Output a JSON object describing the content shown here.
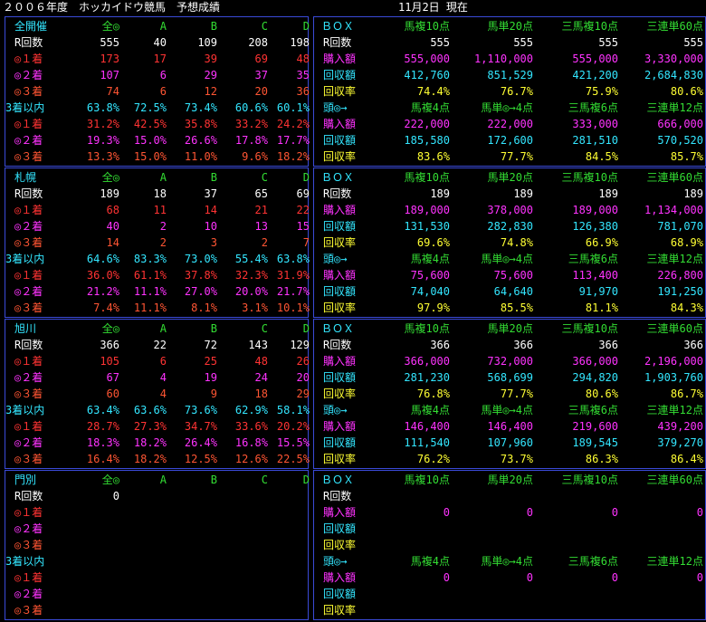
{
  "header": {
    "title": "２００６年度　ホッカイドウ競馬　予想成績",
    "date": "11月2日 現在"
  },
  "colors": {
    "blue": "#3a4ad8",
    "cyan": "#33e6ff",
    "red": "#ff3333",
    "magenta": "#ff33ff",
    "orange": "#ff5533",
    "green": "#33dd33",
    "yellow": "#ffff33",
    "white": "#ffffff"
  },
  "sections": [
    {
      "name": "全開催",
      "left": {
        "cols": [
          "全◎",
          "A",
          "B",
          "C",
          "D"
        ],
        "rows": [
          {
            "label": "R回数",
            "values": [
              "555",
              "40",
              "109",
              "208",
              "198"
            ]
          },
          {
            "label": "◎１着",
            "values": [
              "173",
              "17",
              "39",
              "69",
              "48"
            ]
          },
          {
            "label": "◎２着",
            "values": [
              "107",
              "6",
              "29",
              "37",
              "35"
            ]
          },
          {
            "label": "◎３着",
            "values": [
              "74",
              "6",
              "12",
              "20",
              "36"
            ]
          },
          {
            "label": "3着以内",
            "values": [
              "63.8%",
              "72.5%",
              "73.4%",
              "60.6%",
              "60.1%"
            ]
          },
          {
            "label": "◎１着",
            "values": [
              "31.2%",
              "42.5%",
              "35.8%",
              "33.2%",
              "24.2%"
            ]
          },
          {
            "label": "◎２着",
            "values": [
              "19.3%",
              "15.0%",
              "26.6%",
              "17.8%",
              "17.7%"
            ]
          },
          {
            "label": "◎３着",
            "values": [
              "13.3%",
              "15.0%",
              "11.0%",
              "9.6%",
              "18.2%"
            ]
          }
        ]
      },
      "right": {
        "head1": [
          "ＢＯＸ",
          "馬複10点",
          "馬単20点",
          "三馬複10点",
          "三連単60点"
        ],
        "rows1": [
          {
            "label": "R回数",
            "values": [
              "555",
              "555",
              "555",
              "555"
            ]
          },
          {
            "label": "購入額",
            "values": [
              "555,000",
              "1,110,000",
              "555,000",
              "3,330,000"
            ]
          },
          {
            "label": "回収額",
            "values": [
              "412,760",
              "851,529",
              "421,200",
              "2,684,830"
            ]
          },
          {
            "label": "回収率",
            "values": [
              "74.4%",
              "76.7%",
              "75.9%",
              "80.6%"
            ]
          }
        ],
        "head2": [
          "頭◎→",
          "馬複4点",
          "馬単◎→4点",
          "三馬複6点",
          "三連単12点"
        ],
        "rows2": [
          {
            "label": "購入額",
            "values": [
              "222,000",
              "222,000",
              "333,000",
              "666,000"
            ]
          },
          {
            "label": "回収額",
            "values": [
              "185,580",
              "172,600",
              "281,510",
              "570,520"
            ]
          },
          {
            "label": "回収率",
            "values": [
              "83.6%",
              "77.7%",
              "84.5%",
              "85.7%"
            ]
          }
        ]
      }
    },
    {
      "name": "札幌",
      "left": {
        "cols": [
          "全◎",
          "A",
          "B",
          "C",
          "D"
        ],
        "rows": [
          {
            "label": "R回数",
            "values": [
              "189",
              "18",
              "37",
              "65",
              "69"
            ]
          },
          {
            "label": "◎１着",
            "values": [
              "68",
              "11",
              "14",
              "21",
              "22"
            ]
          },
          {
            "label": "◎２着",
            "values": [
              "40",
              "2",
              "10",
              "13",
              "15"
            ]
          },
          {
            "label": "◎３着",
            "values": [
              "14",
              "2",
              "3",
              "2",
              "7"
            ]
          },
          {
            "label": "3着以内",
            "values": [
              "64.6%",
              "83.3%",
              "73.0%",
              "55.4%",
              "63.8%"
            ]
          },
          {
            "label": "◎１着",
            "values": [
              "36.0%",
              "61.1%",
              "37.8%",
              "32.3%",
              "31.9%"
            ]
          },
          {
            "label": "◎２着",
            "values": [
              "21.2%",
              "11.1%",
              "27.0%",
              "20.0%",
              "21.7%"
            ]
          },
          {
            "label": "◎３着",
            "values": [
              "7.4%",
              "11.1%",
              "8.1%",
              "3.1%",
              "10.1%"
            ]
          }
        ]
      },
      "right": {
        "head1": [
          "ＢＯＸ",
          "馬複10点",
          "馬単20点",
          "三馬複10点",
          "三連単60点"
        ],
        "rows1": [
          {
            "label": "R回数",
            "values": [
              "189",
              "189",
              "189",
              "189"
            ]
          },
          {
            "label": "購入額",
            "values": [
              "189,000",
              "378,000",
              "189,000",
              "1,134,000"
            ]
          },
          {
            "label": "回収額",
            "values": [
              "131,530",
              "282,830",
              "126,380",
              "781,070"
            ]
          },
          {
            "label": "回収率",
            "values": [
              "69.6%",
              "74.8%",
              "66.9%",
              "68.9%"
            ]
          }
        ],
        "head2": [
          "頭◎→",
          "馬複4点",
          "馬単◎→4点",
          "三馬複6点",
          "三連単12点"
        ],
        "rows2": [
          {
            "label": "購入額",
            "values": [
              "75,600",
              "75,600",
              "113,400",
              "226,800"
            ]
          },
          {
            "label": "回収額",
            "values": [
              "74,040",
              "64,640",
              "91,970",
              "191,250"
            ]
          },
          {
            "label": "回収率",
            "values": [
              "97.9%",
              "85.5%",
              "81.1%",
              "84.3%"
            ]
          }
        ]
      }
    },
    {
      "name": "旭川",
      "left": {
        "cols": [
          "全◎",
          "A",
          "B",
          "C",
          "D"
        ],
        "rows": [
          {
            "label": "R回数",
            "values": [
              "366",
              "22",
              "72",
              "143",
              "129"
            ]
          },
          {
            "label": "◎１着",
            "values": [
              "105",
              "6",
              "25",
              "48",
              "26"
            ]
          },
          {
            "label": "◎２着",
            "values": [
              "67",
              "4",
              "19",
              "24",
              "20"
            ]
          },
          {
            "label": "◎３着",
            "values": [
              "60",
              "4",
              "9",
              "18",
              "29"
            ]
          },
          {
            "label": "3着以内",
            "values": [
              "63.4%",
              "63.6%",
              "73.6%",
              "62.9%",
              "58.1%"
            ]
          },
          {
            "label": "◎１着",
            "values": [
              "28.7%",
              "27.3%",
              "34.7%",
              "33.6%",
              "20.2%"
            ]
          },
          {
            "label": "◎２着",
            "values": [
              "18.3%",
              "18.2%",
              "26.4%",
              "16.8%",
              "15.5%"
            ]
          },
          {
            "label": "◎３着",
            "values": [
              "16.4%",
              "18.2%",
              "12.5%",
              "12.6%",
              "22.5%"
            ]
          }
        ]
      },
      "right": {
        "head1": [
          "ＢＯＸ",
          "馬複10点",
          "馬単20点",
          "三馬複10点",
          "三連単60点"
        ],
        "rows1": [
          {
            "label": "R回数",
            "values": [
              "366",
              "366",
              "366",
              "366"
            ]
          },
          {
            "label": "購入額",
            "values": [
              "366,000",
              "732,000",
              "366,000",
              "2,196,000"
            ]
          },
          {
            "label": "回収額",
            "values": [
              "281,230",
              "568,699",
              "294,820",
              "1,903,760"
            ]
          },
          {
            "label": "回収率",
            "values": [
              "76.8%",
              "77.7%",
              "80.6%",
              "86.7%"
            ]
          }
        ],
        "head2": [
          "頭◎→",
          "馬複4点",
          "馬単◎→4点",
          "三馬複6点",
          "三連単12点"
        ],
        "rows2": [
          {
            "label": "購入額",
            "values": [
              "146,400",
              "146,400",
              "219,600",
              "439,200"
            ]
          },
          {
            "label": "回収額",
            "values": [
              "111,540",
              "107,960",
              "189,545",
              "379,270"
            ]
          },
          {
            "label": "回収率",
            "values": [
              "76.2%",
              "73.7%",
              "86.3%",
              "86.4%"
            ]
          }
        ]
      }
    },
    {
      "name": "門別",
      "left": {
        "cols": [
          "全◎",
          "A",
          "B",
          "C",
          "D"
        ],
        "rows": [
          {
            "label": "R回数",
            "values": [
              "0",
              "",
              "",
              "",
              ""
            ]
          },
          {
            "label": "◎１着",
            "values": [
              "",
              "",
              "",
              "",
              ""
            ]
          },
          {
            "label": "◎２着",
            "values": [
              "",
              "",
              "",
              "",
              ""
            ]
          },
          {
            "label": "◎３着",
            "values": [
              "",
              "",
              "",
              "",
              ""
            ]
          },
          {
            "label": "3着以内",
            "values": [
              "",
              "",
              "",
              "",
              ""
            ]
          },
          {
            "label": "◎１着",
            "values": [
              "",
              "",
              "",
              "",
              ""
            ]
          },
          {
            "label": "◎２着",
            "values": [
              "",
              "",
              "",
              "",
              ""
            ]
          },
          {
            "label": "◎３着",
            "values": [
              "",
              "",
              "",
              "",
              ""
            ]
          }
        ]
      },
      "right": {
        "head1": [
          "ＢＯＸ",
          "馬複10点",
          "馬単20点",
          "三馬複10点",
          "三連単60点"
        ],
        "rows1": [
          {
            "label": "R回数",
            "values": [
              "",
              "",
              "",
              ""
            ]
          },
          {
            "label": "購入額",
            "values": [
              "0",
              "0",
              "0",
              "0"
            ]
          },
          {
            "label": "回収額",
            "values": [
              "",
              "",
              "",
              ""
            ]
          },
          {
            "label": "回収率",
            "values": [
              "",
              "",
              "",
              ""
            ]
          }
        ],
        "head2": [
          "頭◎→",
          "馬複4点",
          "馬単◎→4点",
          "三馬複6点",
          "三連単12点"
        ],
        "rows2": [
          {
            "label": "購入額",
            "values": [
              "0",
              "0",
              "0",
              "0"
            ]
          },
          {
            "label": "回収額",
            "values": [
              "",
              "",
              "",
              ""
            ]
          },
          {
            "label": "回収率",
            "values": [
              "",
              "",
              "",
              ""
            ]
          }
        ]
      }
    }
  ]
}
